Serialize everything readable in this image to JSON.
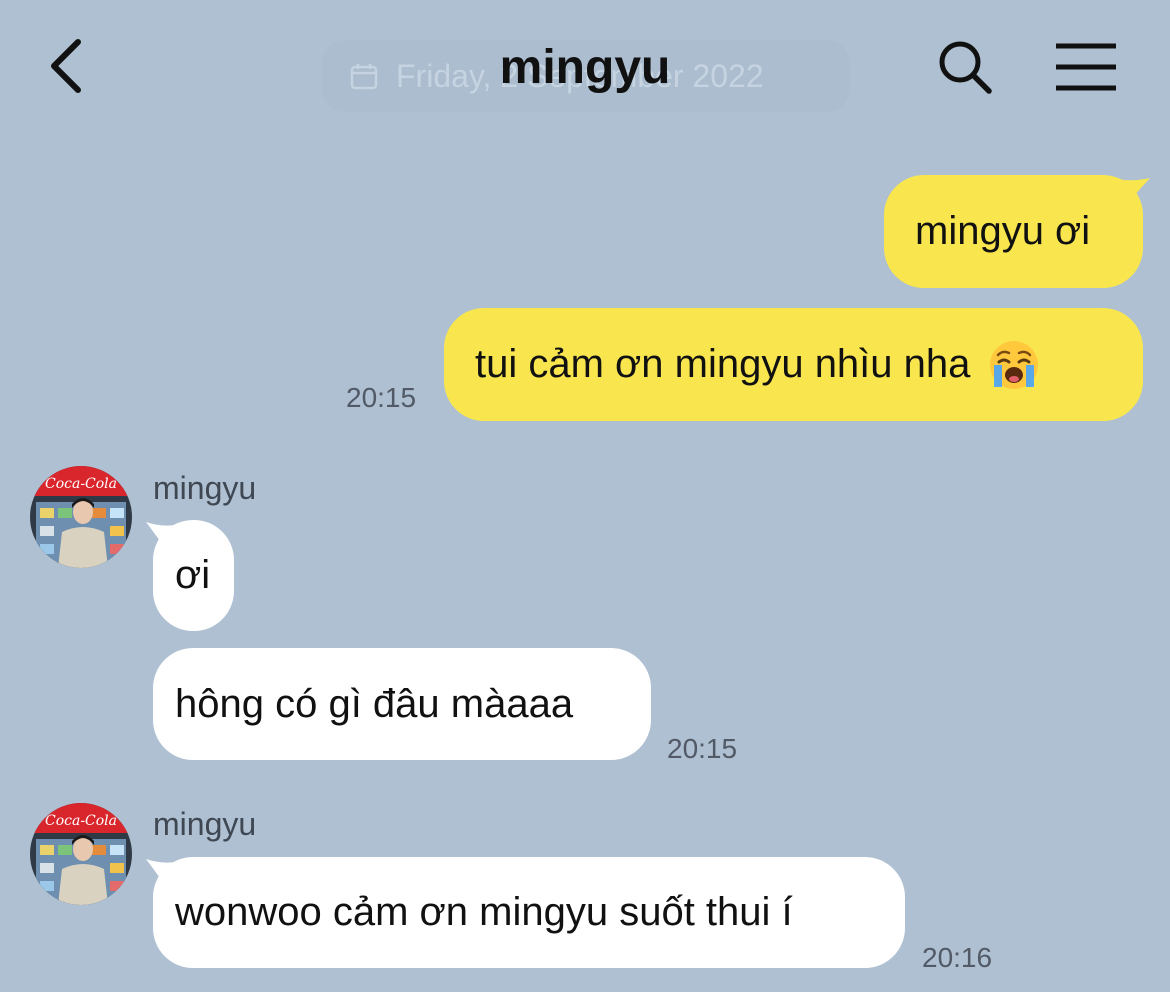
{
  "header": {
    "title": "mingyu",
    "date_banner": "Friday, 2 September 2022",
    "back_icon": "chevron-left-icon",
    "search_icon": "search-icon",
    "menu_icon": "hamburger-menu-icon"
  },
  "colors": {
    "background": "#AEC0D1",
    "outgoing_bubble": "#F9E64E",
    "incoming_bubble": "#FFFFFF"
  },
  "messages": {
    "out_1": {
      "text": "mingyu ơi"
    },
    "out_2": {
      "text": "tui cảm ơn mingyu nhìu nha",
      "emoji": "loudly-crying-face",
      "time": "20:15"
    },
    "group_1": {
      "sender": "mingyu",
      "msg_1": {
        "text": "ơi"
      },
      "msg_2": {
        "text": "hông có gì đâu màaaa",
        "time": "20:15"
      }
    },
    "group_2": {
      "sender": "mingyu",
      "msg_1": {
        "text": "wonwoo cảm ơn mingyu suốt thui í",
        "time": "20:16"
      }
    }
  }
}
